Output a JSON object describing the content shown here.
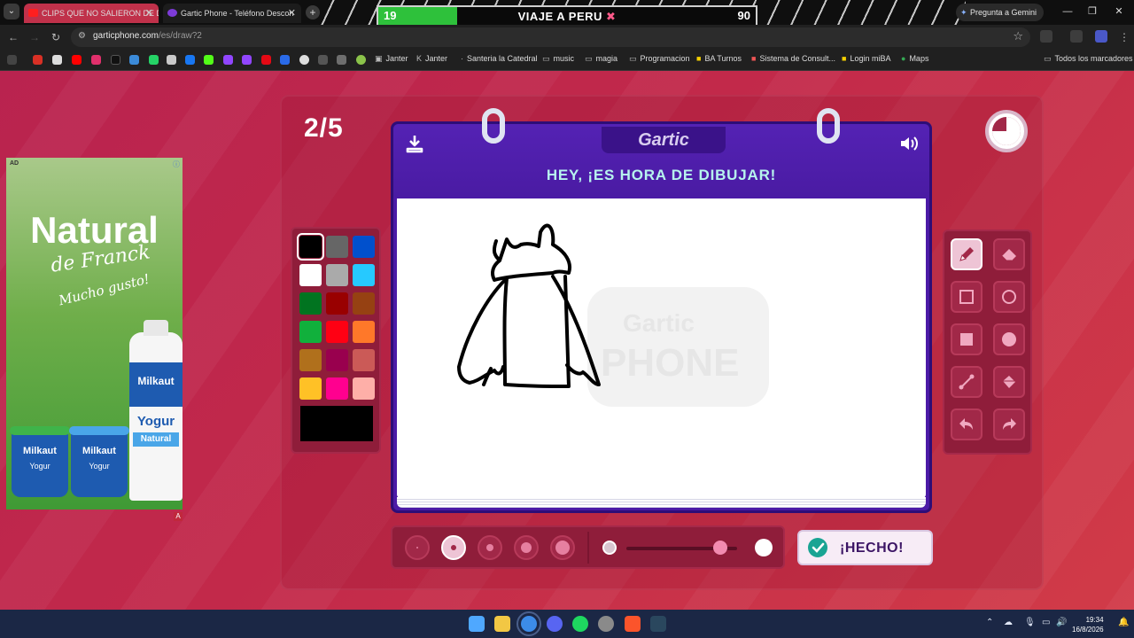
{
  "browser": {
    "tabs": [
      {
        "label": "CLIPS QUE NO SALIERON DE D",
        "close": "✕"
      },
      {
        "label": "Gartic Phone - Teléfono Descon",
        "close": "✕"
      }
    ],
    "url_host": "garticphone.com",
    "url_path": "/es/draw?2",
    "gemini": "Pregunta a Gemini",
    "bookmarks": [
      {
        "label": "Janter"
      },
      {
        "label": "Janter"
      },
      {
        "label": "Santeria la Catedral"
      },
      {
        "label": "music"
      },
      {
        "label": "magia"
      },
      {
        "label": "Programacion"
      },
      {
        "label": "BA Turnos"
      },
      {
        "label": "Sistema de Consult..."
      },
      {
        "label": "Login miBA"
      },
      {
        "label": "Maps"
      }
    ],
    "all_bookmarks": "Todos los marcadores"
  },
  "stream_overlay": {
    "left_value": "19",
    "title": "VIAJE A PERU",
    "cross": "✖",
    "right_value": "90",
    "progress": 0.21
  },
  "ad": {
    "tag": "AD",
    "title": "Natural",
    "sub": "de Franck",
    "slogan": "Mucho gusto!",
    "cup1_brand": "Milkaut",
    "cup1_kind": "Yogur",
    "cup2_brand": "Milkaut",
    "cup2_kind": "Yogur",
    "bottle_brand": "Milkaut",
    "bottle_kind": "Yogur",
    "bottle_variant": "Natural",
    "corner": "A"
  },
  "game": {
    "round": "2/5",
    "logo": "Gartic",
    "heading": "HEY, ¡ES HORA DE DIBUJAR!",
    "done_label": "¡HECHO!",
    "timer_progress": 0.75,
    "brush_opacity": 0.85
  },
  "palette": [
    "#000000",
    "#666666",
    "#0050cd",
    "#ffffff",
    "#aaaaaa",
    "#26c9ff",
    "#017420",
    "#990000",
    "#964112",
    "#11b03c",
    "#ff0013",
    "#ff7829",
    "#b0701c",
    "#99004e",
    "#cb5a57",
    "#ffc126",
    "#ff008f",
    "#feafa8"
  ],
  "current_color": "#000000",
  "colors": {
    "accent_purple": "#4b1aa6",
    "heading_teal": "#b7f4ee",
    "done_check": "#19a493"
  },
  "taskbar": {
    "time": "19:34",
    "date": "16/8/2026"
  }
}
